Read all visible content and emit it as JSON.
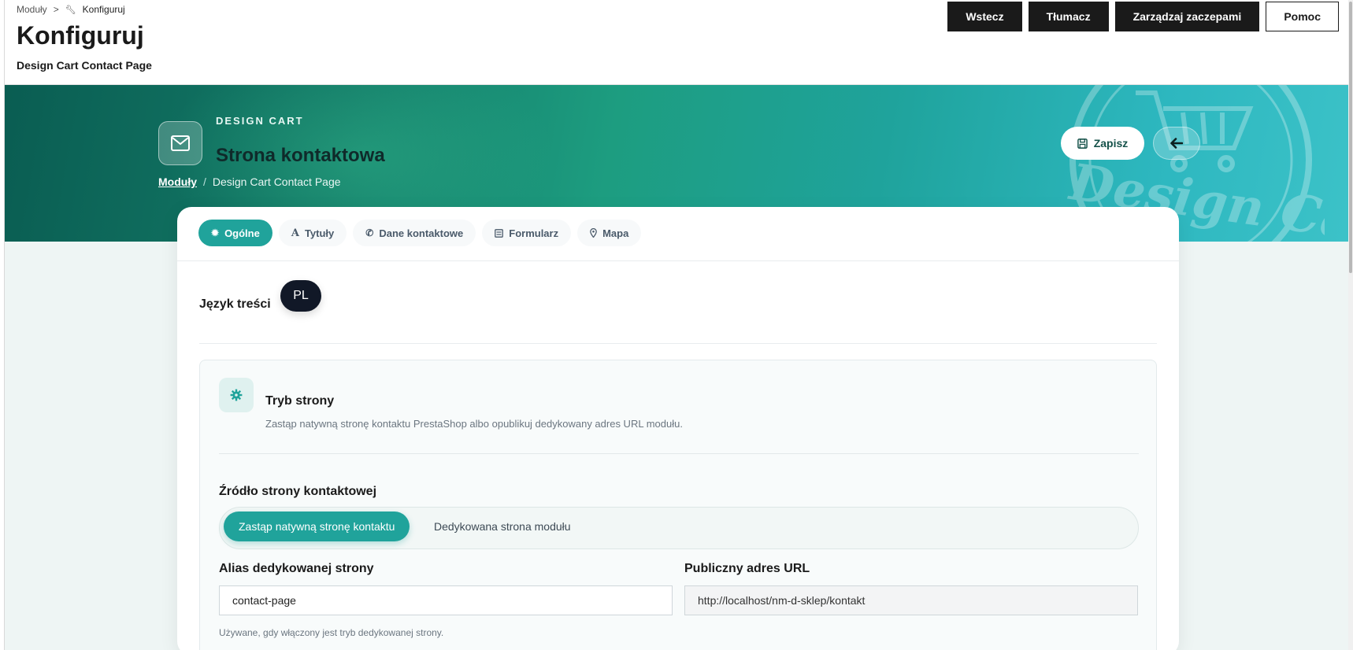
{
  "breadcrumb": {
    "first": "Moduły",
    "separator": ">",
    "current": "Konfiguruj"
  },
  "header": {
    "title": "Konfiguruj",
    "subtitle": "Design Cart Contact Page"
  },
  "toolbar": {
    "back": "Wstecz",
    "translate": "Tłumacz",
    "hooks": "Zarządzaj zaczepami",
    "help": "Pomoc"
  },
  "hero": {
    "kicker": "DESIGN CART",
    "title": "Strona kontaktowa",
    "crumb_link": "Moduły",
    "crumb_sep": "/",
    "crumb_current": "Design Cart Contact Page",
    "save_label": "Zapisz",
    "watermark_text": "Design Cart"
  },
  "tabs": [
    {
      "label": "Ogólne",
      "icon": "gear-icon",
      "active": true
    },
    {
      "label": "Tytuły",
      "icon": "text-icon",
      "active": false
    },
    {
      "label": "Dane kontaktowe",
      "icon": "phone-icon",
      "active": false
    },
    {
      "label": "Formularz",
      "icon": "form-icon",
      "active": false
    },
    {
      "label": "Mapa",
      "icon": "map-pin-icon",
      "active": false
    }
  ],
  "language": {
    "label": "Język treści",
    "value": "PL"
  },
  "mode": {
    "title": "Tryb strony",
    "description": "Zastąp natywną stronę kontaktu PrestaShop albo opublikuj dedykowany adres URL modułu.",
    "source_label": "Źródło strony kontaktowej",
    "options": [
      "Zastąp natywną stronę kontaktu",
      "Dedykowana strona modułu"
    ],
    "selected": "Zastąp natywną stronę kontaktu"
  },
  "fields": {
    "alias_label": "Alias dedykowanej strony",
    "alias_value": "contact-page",
    "alias_help": "Używane, gdy włączony jest tryb dedykowanej strony.",
    "url_label": "Publiczny adres URL",
    "url_value": "http://localhost/nm-d-sklep/kontakt"
  },
  "colors": {
    "accent": "#20a39b",
    "dark": "#1a1a1a",
    "pill": "#111827"
  }
}
